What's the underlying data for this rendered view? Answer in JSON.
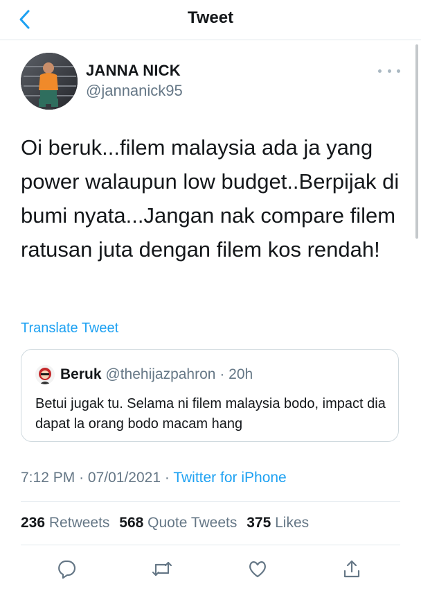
{
  "header": {
    "title": "Tweet",
    "back_icon": "chevron-left-icon"
  },
  "author": {
    "name": "JANNA NICK",
    "handle": "@jannanick95"
  },
  "tweet": {
    "text": "Oi beruk...filem malaysia ada ja yang power walaupun low budget..Berpijak di bumi nyata...Jangan nak compare filem ratusan juta dengan filem kos rendah!",
    "translate_label": "Translate Tweet"
  },
  "quote": {
    "name": "Beruk",
    "handle": "@thehijazpahron",
    "separator": "·",
    "time": "20h",
    "text": "Betui jugak tu. Selama ni filem malaysia bodo, impact dia dapat la orang bodo macam hang"
  },
  "meta": {
    "time": "7:12 PM",
    "separator": "·",
    "date": "07/01/2021",
    "source": "Twitter for iPhone"
  },
  "stats": {
    "retweets_count": "236",
    "retweets_label": "Retweets",
    "quotes_count": "568",
    "quotes_label": "Quote Tweets",
    "likes_count": "375",
    "likes_label": "Likes"
  },
  "actions": [
    "reply-icon",
    "retweet-icon",
    "like-icon",
    "share-icon"
  ],
  "colors": {
    "accent": "#1da1f2",
    "text": "#14171a",
    "muted": "#657786",
    "border": "#e1e8ed"
  }
}
